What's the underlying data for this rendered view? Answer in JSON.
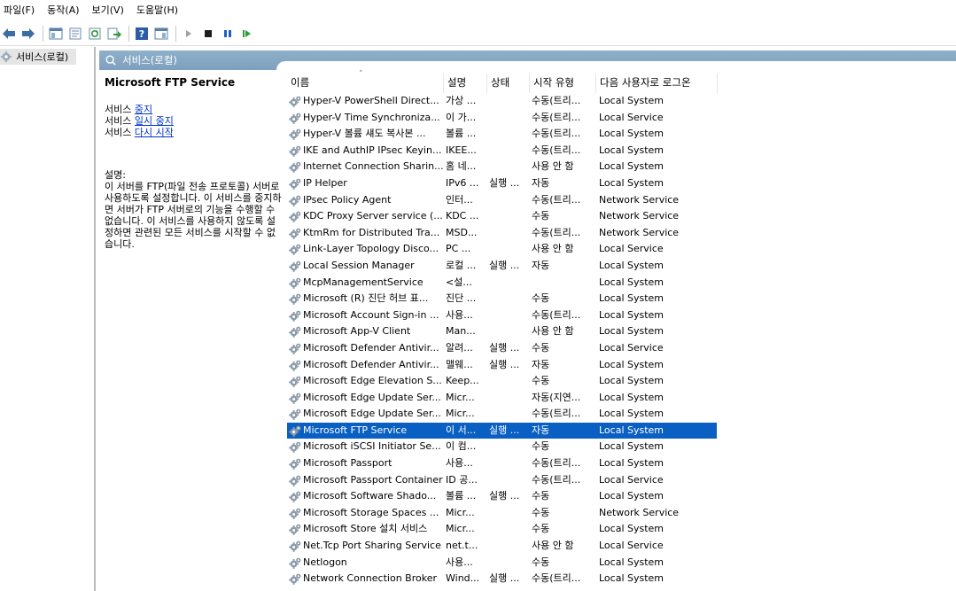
{
  "menubar": {
    "items": [
      "파일(F)",
      "동작(A)",
      "보기(V)",
      "도움말(H)"
    ]
  },
  "toolbar": {
    "buttons": [
      "back-icon",
      "forward-icon",
      "show-hide-console-tree-icon",
      "properties-icon",
      "refresh-icon",
      "export-list-icon",
      "help-icon",
      "show-action-pane-icon",
      "start-service-icon",
      "stop-service-icon",
      "pause-service-icon",
      "resume-service-icon"
    ]
  },
  "tree": {
    "root_label": "서비스(로컬)"
  },
  "panel": {
    "title": "서비스(로컬)"
  },
  "description_pane": {
    "service_name": "Microsoft FTP Service",
    "actions": [
      {
        "prefix": "서비스 ",
        "link": "중지"
      },
      {
        "prefix": "서비스 ",
        "link": "일시 중지"
      },
      {
        "prefix": "서비스 ",
        "link": "다시 시작"
      }
    ],
    "desc_label": "설명:",
    "desc_text": "이 서버를 FTP(파일 전송 프로토콜) 서버로 사용하도록 설정합니다. 이 서비스를 중지하면 서버가 FTP 서버로의 기능을 수행할 수 없습니다. 이 서비스를 사용하지 않도록 설정하면 관련된 모든 서비스를 시작할 수 없습니다."
  },
  "columns": {
    "name": "이름",
    "description": "설명",
    "status": "상태",
    "startup": "시작 유형",
    "logon": "다음 사용자로 로그온"
  },
  "selected_index": 20,
  "colors": {
    "selection": "#0a5fc2",
    "header_gradient_top": "#8fb0ca",
    "link": "#0033cc"
  },
  "services": [
    {
      "name": "Hyper-V PowerShell Direct...",
      "desc": "가상 ...",
      "status": "",
      "startup": "수동(트리...",
      "logon": "Local System"
    },
    {
      "name": "Hyper-V Time Synchroniza...",
      "desc": "이 가...",
      "status": "",
      "startup": "수동(트리...",
      "logon": "Local Service"
    },
    {
      "name": "Hyper-V 볼륨 섀도 복사본 ...",
      "desc": "볼륨 ...",
      "status": "",
      "startup": "수동(트리...",
      "logon": "Local System"
    },
    {
      "name": "IKE and AuthIP IPsec Keyin...",
      "desc": "IKEE...",
      "status": "",
      "startup": "수동(트리...",
      "logon": "Local System"
    },
    {
      "name": "Internet Connection Sharin...",
      "desc": "홈 네...",
      "status": "",
      "startup": "사용 안 함",
      "logon": "Local System"
    },
    {
      "name": "IP Helper",
      "desc": "IPv6 ...",
      "status": "실행 ...",
      "startup": "자동",
      "logon": "Local System"
    },
    {
      "name": "IPsec Policy Agent",
      "desc": "인터...",
      "status": "",
      "startup": "수동(트리...",
      "logon": "Network Service"
    },
    {
      "name": "KDC Proxy Server service (...",
      "desc": "KDC ...",
      "status": "",
      "startup": "수동",
      "logon": "Network Service"
    },
    {
      "name": "KtmRm for Distributed Tra...",
      "desc": "MSD...",
      "status": "",
      "startup": "수동(트리...",
      "logon": "Network Service"
    },
    {
      "name": "Link-Layer Topology Disco...",
      "desc": "PC ...",
      "status": "",
      "startup": "사용 안 함",
      "logon": "Local Service"
    },
    {
      "name": "Local Session Manager",
      "desc": "로컬 ...",
      "status": "실행 ...",
      "startup": "자동",
      "logon": "Local System"
    },
    {
      "name": "McpManagementService",
      "desc": "<설...",
      "status": "",
      "startup": "",
      "logon": "Local System"
    },
    {
      "name": "Microsoft (R) 진단 허브 표...",
      "desc": "진단 ...",
      "status": "",
      "startup": "수동",
      "logon": "Local System"
    },
    {
      "name": "Microsoft Account Sign-in ...",
      "desc": "사용...",
      "status": "",
      "startup": "수동(트리...",
      "logon": "Local System"
    },
    {
      "name": "Microsoft App-V Client",
      "desc": "Man...",
      "status": "",
      "startup": "사용 안 함",
      "logon": "Local System"
    },
    {
      "name": "Microsoft Defender Antivir...",
      "desc": "알려...",
      "status": "실행 ...",
      "startup": "수동",
      "logon": "Local Service"
    },
    {
      "name": "Microsoft Defender Antivir...",
      "desc": "맬웨...",
      "status": "실행 ...",
      "startup": "자동",
      "logon": "Local System"
    },
    {
      "name": "Microsoft Edge Elevation S...",
      "desc": "Keep...",
      "status": "",
      "startup": "수동",
      "logon": "Local System"
    },
    {
      "name": "Microsoft Edge Update Ser...",
      "desc": "Micr...",
      "status": "",
      "startup": "자동(지연...",
      "logon": "Local System"
    },
    {
      "name": "Microsoft Edge Update Ser...",
      "desc": "Micr...",
      "status": "",
      "startup": "수동(트리...",
      "logon": "Local System"
    },
    {
      "name": "Microsoft FTP Service",
      "desc": "이 서...",
      "status": "실행 ...",
      "startup": "자동",
      "logon": "Local System"
    },
    {
      "name": "Microsoft iSCSI Initiator Se...",
      "desc": "이 컴...",
      "status": "",
      "startup": "수동",
      "logon": "Local System"
    },
    {
      "name": "Microsoft Passport",
      "desc": "사용...",
      "status": "",
      "startup": "수동(트리...",
      "logon": "Local System"
    },
    {
      "name": "Microsoft Passport Container",
      "desc": "ID 공...",
      "status": "",
      "startup": "수동(트리...",
      "logon": "Local Service"
    },
    {
      "name": "Microsoft Software Shado...",
      "desc": "볼륨 ...",
      "status": "실행 ...",
      "startup": "수동",
      "logon": "Local System"
    },
    {
      "name": "Microsoft Storage Spaces ...",
      "desc": "Micr...",
      "status": "",
      "startup": "수동",
      "logon": "Network Service"
    },
    {
      "name": "Microsoft Store 설치 서비스",
      "desc": "Micr...",
      "status": "",
      "startup": "수동",
      "logon": "Local System"
    },
    {
      "name": "Net.Tcp Port Sharing Service",
      "desc": "net.t...",
      "status": "",
      "startup": "사용 안 함",
      "logon": "Local Service"
    },
    {
      "name": "Netlogon",
      "desc": "사용...",
      "status": "",
      "startup": "수동",
      "logon": "Local System"
    },
    {
      "name": "Network Connection Broker",
      "desc": "Wind...",
      "status": "실행 ...",
      "startup": "수동(트리...",
      "logon": "Local System"
    }
  ]
}
